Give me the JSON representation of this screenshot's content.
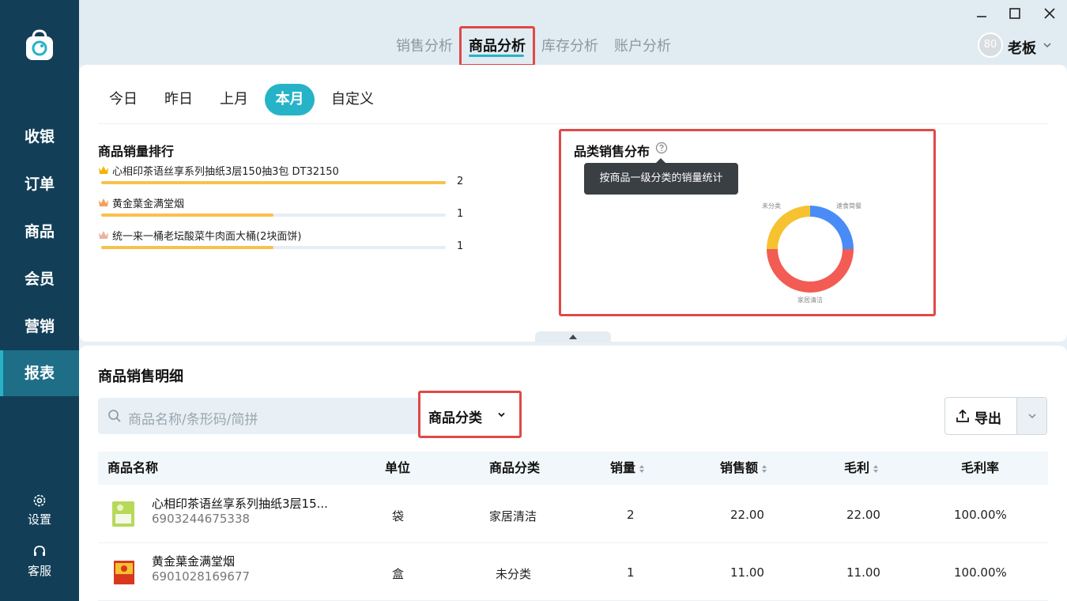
{
  "sidebar": {
    "logo": "shopping-bag-logo",
    "items": [
      {
        "label": "收银"
      },
      {
        "label": "订单"
      },
      {
        "label": "商品"
      },
      {
        "label": "会员"
      },
      {
        "label": "营销"
      },
      {
        "label": "报表",
        "active": true
      }
    ],
    "footer": [
      {
        "label": "设置",
        "icon": "gear-icon"
      },
      {
        "label": "客服",
        "icon": "headset-icon"
      }
    ]
  },
  "header": {
    "tabs": [
      {
        "label": "销售分析"
      },
      {
        "label": "商品分析",
        "active": true
      },
      {
        "label": "库存分析"
      },
      {
        "label": "账户分析"
      }
    ],
    "user": {
      "avatar_text": "80",
      "name": "老板"
    },
    "window_controls": [
      "minimize-icon",
      "maximize-icon",
      "close-icon"
    ]
  },
  "date_filter": {
    "options": [
      {
        "label": "今日"
      },
      {
        "label": "昨日"
      },
      {
        "label": "上月"
      },
      {
        "label": "本月",
        "active": true
      },
      {
        "label": "自定义"
      }
    ]
  },
  "ranking": {
    "title": "商品销量排行",
    "items": [
      {
        "name": "心相印茶语丝享系列抽纸3层150抽3包 DT32150",
        "value": "2",
        "fill": 1.0,
        "crown_color": "#f5b400"
      },
      {
        "name": "黄金葉金满堂烟",
        "value": "1",
        "fill": 0.5,
        "crown_color": "#f0a35c"
      },
      {
        "name": "统一来一桶老坛酸菜牛肉面大桶(2块面饼)",
        "value": "1",
        "fill": 0.5,
        "crown_color": "#e8b4a4"
      }
    ]
  },
  "category_dist": {
    "title": "品类销售分布",
    "tooltip": "按商品一级分类的销量统计",
    "labels": {
      "uncategorized": "未分类",
      "fast_food": "速食简餐",
      "home_cleaning": "家居清洁"
    }
  },
  "chart_data": {
    "type": "pie",
    "categories": [
      "速食简餐",
      "家居清洁",
      "未分类"
    ],
    "values": [
      1,
      2,
      1
    ],
    "colors": [
      "#4a8cf7",
      "#f25c54",
      "#f7c230"
    ]
  },
  "detail": {
    "title": "商品销售明细",
    "search_placeholder": "商品名称/条形码/简拼",
    "category_select": "商品分类",
    "export_label": "导出",
    "columns": [
      "商品名称",
      "单位",
      "商品分类",
      "销量",
      "销售额",
      "毛利",
      "毛利率"
    ],
    "rows": [
      {
        "name": "心相印茶语丝享系列抽纸3层15...",
        "code": "6903244675338",
        "unit": "袋",
        "category": "家居清洁",
        "qty": "2",
        "amount": "22.00",
        "profit": "22.00",
        "rate": "100.00%"
      },
      {
        "name": "黄金葉金满堂烟",
        "code": "6901028169677",
        "unit": "盒",
        "category": "未分类",
        "qty": "1",
        "amount": "11.00",
        "profit": "11.00",
        "rate": "100.00%"
      }
    ]
  },
  "colors": {
    "sidebar": "#123f57",
    "accent": "#27b3c7",
    "highlight": "#e04848"
  }
}
